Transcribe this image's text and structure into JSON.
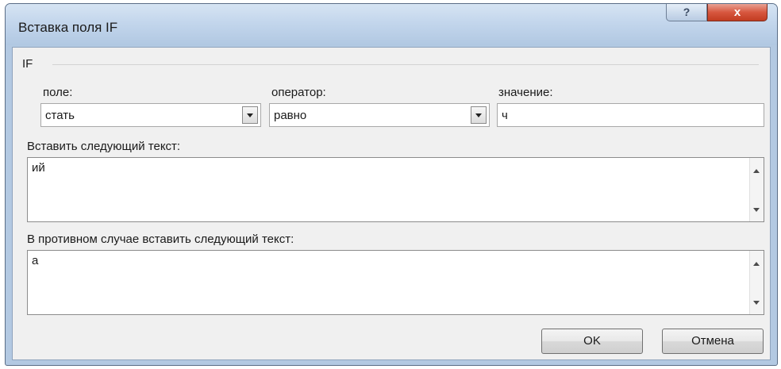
{
  "window": {
    "title": "Вставка поля IF",
    "help_glyph": "?",
    "close_glyph": "x"
  },
  "group": {
    "label": "IF"
  },
  "field": {
    "label": "поле:",
    "value": "стать"
  },
  "operator": {
    "label": "оператор:",
    "value": "равно"
  },
  "compare": {
    "label": "значение:",
    "value": "ч"
  },
  "insert_text": {
    "label": "Вставить следующий текст:",
    "value": "ий"
  },
  "else_text": {
    "label": "В противном случае вставить следующий текст:",
    "value": "а"
  },
  "buttons": {
    "ok": "OK",
    "cancel": "Отмена"
  }
}
